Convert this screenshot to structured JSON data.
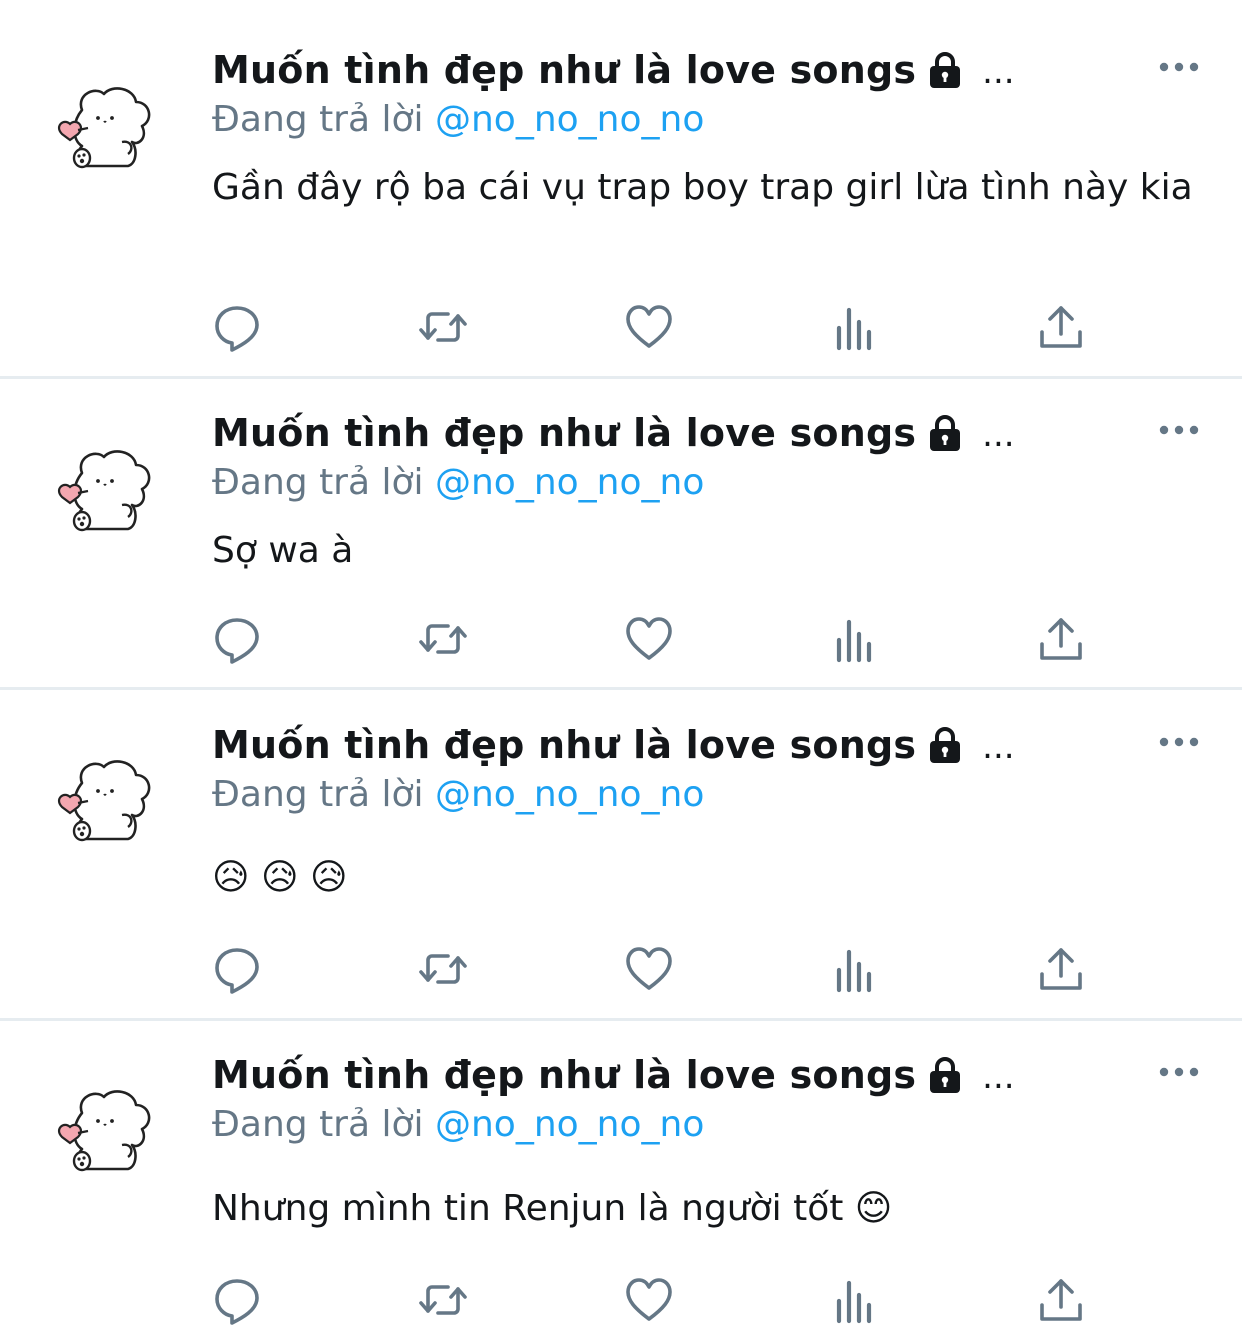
{
  "colors": {
    "text": "#14171a",
    "secondary": "#657786",
    "link": "#1da1f2",
    "icon": "#657786",
    "divider": "#e6ecf0"
  },
  "tweets": [
    {
      "display_name": "Muốn tình đẹp như là love songs",
      "ellipsis": "...",
      "reply_prefix": "Đang trả lời",
      "reply_handle": "@no_no_no_no",
      "text": "Gần đây rộ ba cái vụ trap boy trap girl lừa tình này kia"
    },
    {
      "display_name": "Muốn tình đẹp như là love songs",
      "ellipsis": "...",
      "reply_prefix": "Đang trả lời",
      "reply_handle": "@no_no_no_no",
      "text": "Sợ wa à"
    },
    {
      "display_name": "Muốn tình đẹp như là love songs",
      "ellipsis": "...",
      "reply_prefix": "Đang trả lời",
      "reply_handle": "@no_no_no_no",
      "text": "😥 😥 😥"
    },
    {
      "display_name": "Muốn tình đẹp như là love songs",
      "ellipsis": "...",
      "reply_prefix": "Đang trả lời",
      "reply_handle": "@no_no_no_no",
      "text": "Nhưng mình tin Renjun là người tốt 😊"
    }
  ],
  "icons": {
    "avatar": "puppy-avatar",
    "lock": "lock-icon",
    "more": "more-dots-icon",
    "actions": [
      "reply-icon",
      "retweet-icon",
      "like-icon",
      "analytics-icon",
      "share-icon"
    ]
  }
}
